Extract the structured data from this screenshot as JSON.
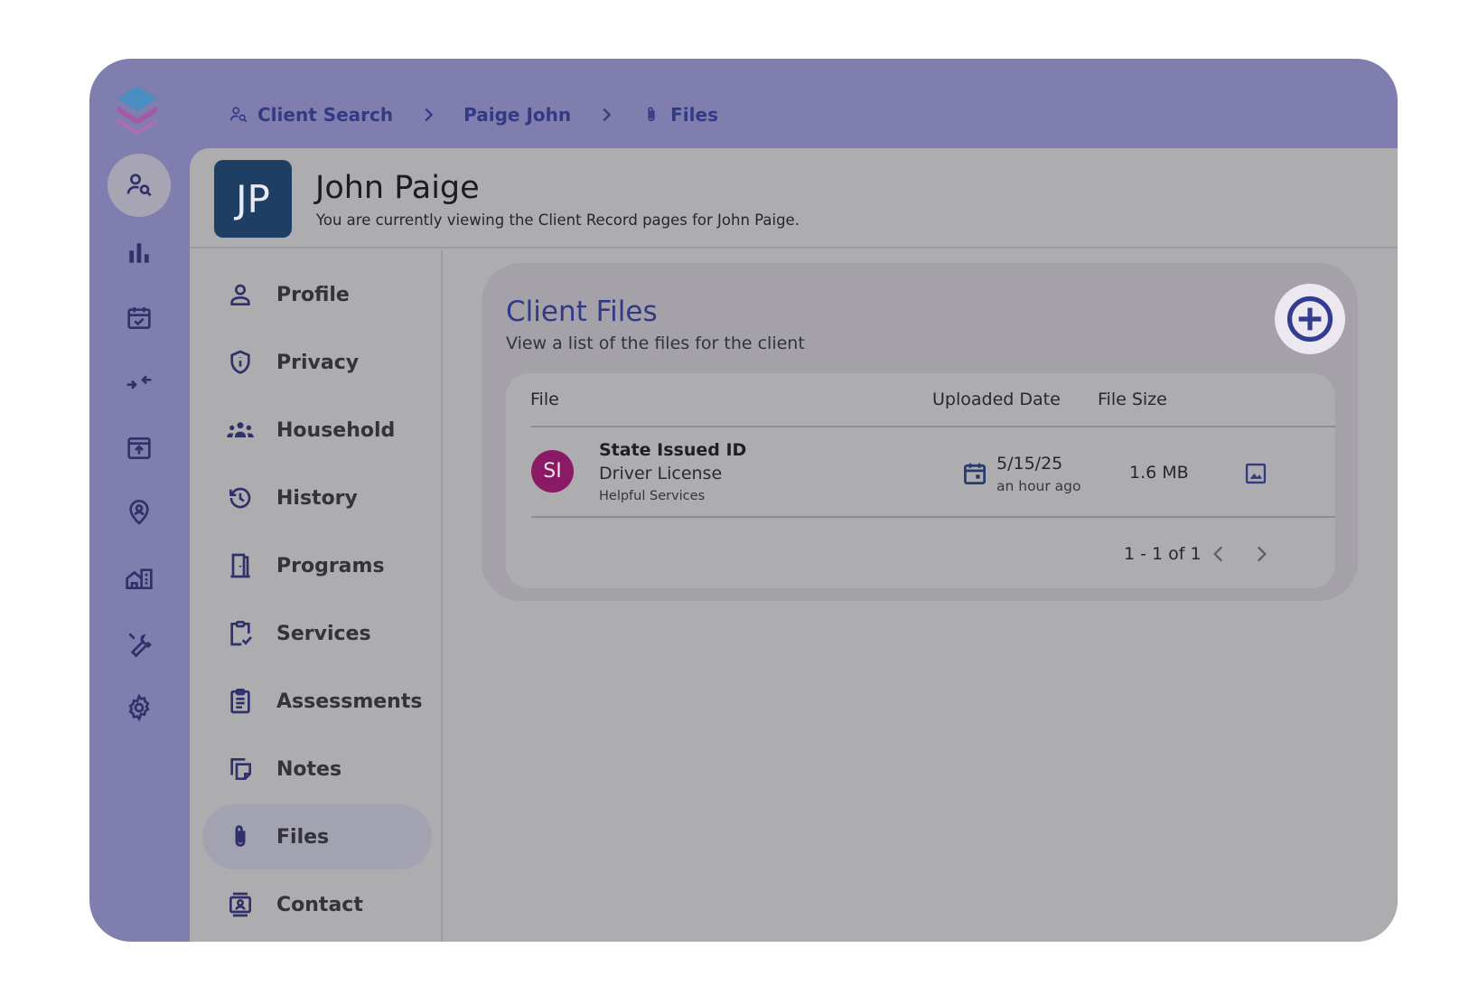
{
  "breadcrumb": [
    {
      "label": "Client Search",
      "icon": "person-search-icon"
    },
    {
      "label": "Paige John"
    },
    {
      "label": "Files",
      "icon": "paperclip-icon"
    }
  ],
  "client": {
    "initials": "JP",
    "name": "John Paige",
    "subtitle": "You are currently viewing the Client Record pages for John Paige."
  },
  "rail": [
    "person-search-icon",
    "bar-chart-icon",
    "calendar-check-icon",
    "merge-arrows-icon",
    "upload-box-icon",
    "location-person-icon",
    "buildings-icon",
    "wrench-icon",
    "gear-icon"
  ],
  "subnav": [
    {
      "label": "Profile",
      "icon": "person-icon"
    },
    {
      "label": "Privacy",
      "icon": "shield-icon"
    },
    {
      "label": "Household",
      "icon": "group-icon"
    },
    {
      "label": "History",
      "icon": "history-icon"
    },
    {
      "label": "Programs",
      "icon": "door-icon"
    },
    {
      "label": "Services",
      "icon": "clipboard-check-icon"
    },
    {
      "label": "Assessments",
      "icon": "clipboard-list-icon"
    },
    {
      "label": "Notes",
      "icon": "notes-icon"
    },
    {
      "label": "Files",
      "icon": "paperclip-icon",
      "active": true
    },
    {
      "label": "Contact",
      "icon": "contact-icon"
    }
  ],
  "files_card": {
    "title": "Client Files",
    "subtitle": "View a list of the files for the client",
    "columns": [
      "File",
      "Uploaded Date",
      "File Size"
    ],
    "rows": [
      {
        "initials": "SI",
        "title": "State Issued ID",
        "type": "Driver License",
        "organization": "Helpful Services",
        "date": "5/15/25",
        "relative": "an hour ago",
        "size": "1.6 MB"
      }
    ],
    "pagination": "1 - 1 of 1"
  },
  "colors": {
    "frame": "#7f7eae",
    "content": "#adacaf",
    "accent": "#313a86",
    "avatar_jp": "#1e3e63",
    "avatar_si": "#8b1a66"
  }
}
